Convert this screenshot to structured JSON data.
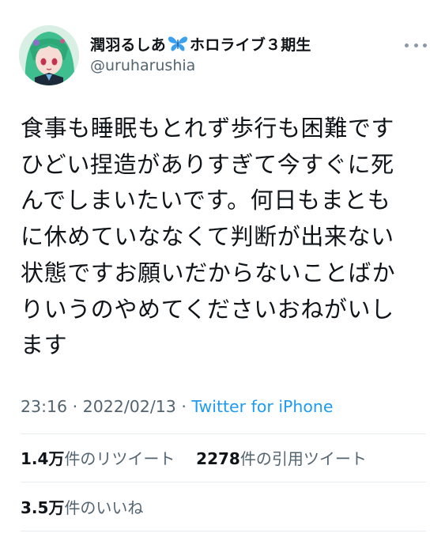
{
  "author": {
    "display_name_before": "潤羽るしあ",
    "display_name_after": "ホロライブ３期生",
    "name_emoji_icon": "blue-butterfly-icon",
    "handle": "@uruharushia",
    "avatar_icon": "green-haired-avatar"
  },
  "menu": {
    "icon": "more-horizontal-icon"
  },
  "tweet": {
    "lines": [
      "食事も睡眠もとれず歩行も困難です",
      "ひどい捏造がありすぎて今すぐに死",
      "んでしまいたいです。何日もまとも",
      "に休めていななくて判断が出来ない",
      "状態ですお願いだからないことばか",
      "りいうのやめてくださいおねがいし",
      "ます"
    ]
  },
  "meta": {
    "time": "23:16",
    "separator": "·",
    "date": "2022/02/13",
    "source": "Twitter for iPhone"
  },
  "stats": {
    "retweets_count": "1.4万",
    "retweets_label": "件のリツイート",
    "quotes_count": "2278",
    "quotes_label": "件の引用ツイート",
    "likes_count": "3.5万",
    "likes_label": "件のいいね"
  },
  "colors": {
    "text": "#0f1419",
    "secondary": "#536471",
    "link": "#1d9bf0",
    "divider": "#e6ecf0",
    "butterfly": "#3aa0f0"
  }
}
